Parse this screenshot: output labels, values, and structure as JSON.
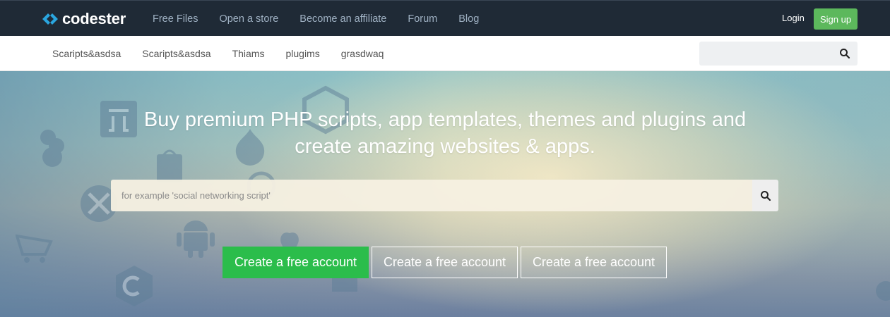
{
  "brand": {
    "name": "codester",
    "logo_icon": "codester-chevrons-icon"
  },
  "main_nav": [
    {
      "label": "Free Files"
    },
    {
      "label": "Open a store"
    },
    {
      "label": "Become an affiliate"
    },
    {
      "label": "Forum"
    },
    {
      "label": "Blog"
    }
  ],
  "auth": {
    "login_label": "Login",
    "signup_label": "Sign up"
  },
  "sub_nav": [
    {
      "label": "Scaripts&asdsa"
    },
    {
      "label": "Scaripts&asdsa"
    },
    {
      "label": "Thiams"
    },
    {
      "label": "plugims"
    },
    {
      "label": "grasdwaq"
    }
  ],
  "sub_search": {
    "value": "",
    "placeholder": "",
    "icon": "search-icon"
  },
  "hero": {
    "title_line1": "Buy premium PHP scripts, app templates, themes and plugins and",
    "title_line2": "create amazing websites & apps.",
    "search_placeholder": "for example 'social networking script'",
    "search_value": "",
    "search_icon": "search-icon",
    "cta_primary": "Create a free account",
    "cta_secondary_1": "Create a free account",
    "cta_secondary_2": "Create a free account"
  },
  "colors": {
    "topbar": "#1f2a36",
    "nav_text": "#9fb1c3",
    "signup": "#5cb85c",
    "cta_primary": "#2bbd4b",
    "logo_accent": "#2aa6e0"
  }
}
